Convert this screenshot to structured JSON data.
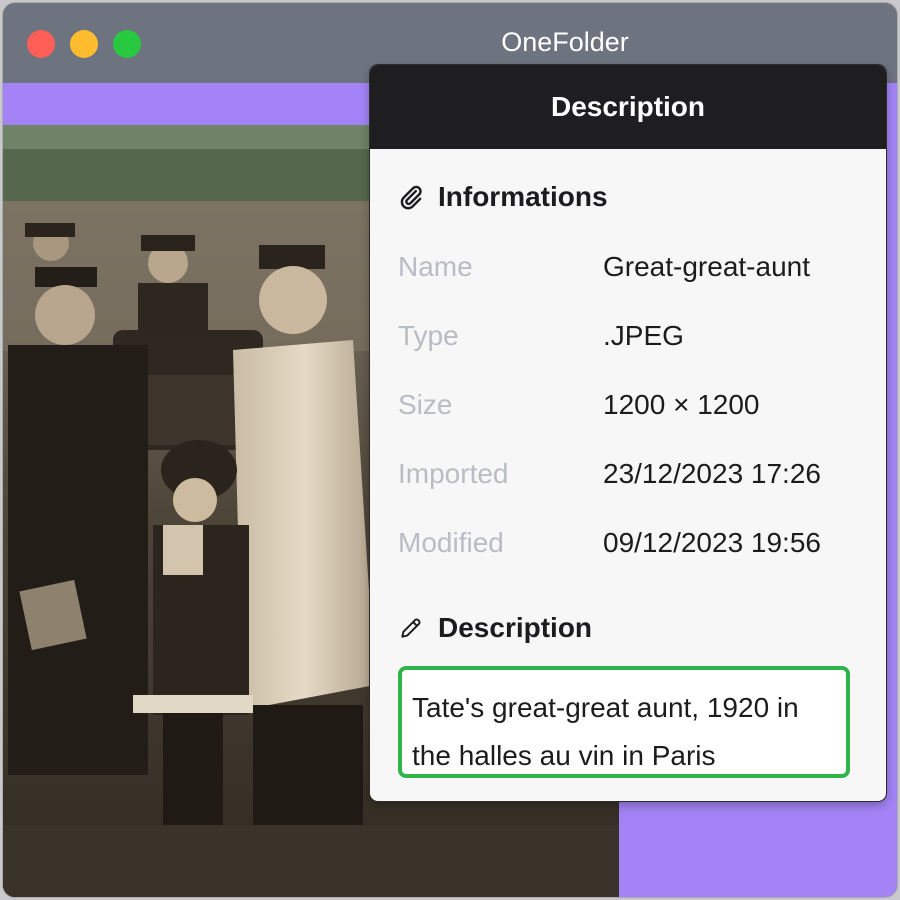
{
  "window": {
    "title": "OneFolder"
  },
  "panel": {
    "header": "Description",
    "info_section_title": "Informations",
    "info_rows": [
      {
        "key": "Name",
        "value": "Great-great-aunt"
      },
      {
        "key": "Type",
        "value": ".JPEG"
      },
      {
        "key": "Size",
        "value": "1200 × 1200"
      },
      {
        "key": "Imported",
        "value": "23/12/2023 17:26"
      },
      {
        "key": "Modified",
        "value": "09/12/2023 19:56"
      }
    ],
    "description_section_title": "Description",
    "description_text": "Tate's great-great aunt, 1920 in the halles au vin in Paris"
  },
  "colors": {
    "titlebar": "#6d737f",
    "app_background": "#a383f6",
    "panel_header": "#1e1e20",
    "focus_border": "#2fb34a",
    "label_gray": "#b9bcc2"
  },
  "icons": {
    "info": "paperclip-icon",
    "description": "pencil-icon"
  },
  "image": {
    "subject": "sepia photograph of a group of men in uniform and a girl standing beside a vintage truck"
  }
}
